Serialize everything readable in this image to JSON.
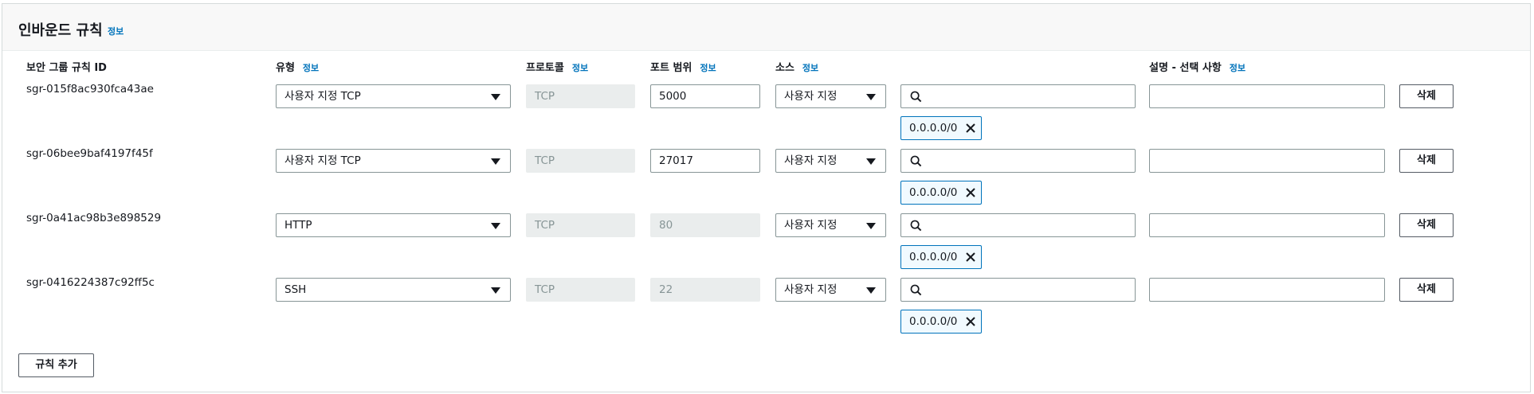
{
  "panel": {
    "title": "인바운드 규칙",
    "info": "정보"
  },
  "columns": {
    "rule_id": "보안 그룹 규칙 ID",
    "type": "유형",
    "protocol": "프로토콜",
    "port_range": "포트 범위",
    "source": "소스",
    "description": "설명 - 선택 사항",
    "info": "정보"
  },
  "rules": [
    {
      "id": "sgr-015f8ac930fca43ae",
      "type": "사용자 지정 TCP",
      "protocol": "TCP",
      "port": "5000",
      "source": "사용자 지정",
      "cidr": "0.0.0.0/0",
      "description": "",
      "delete": "삭제"
    },
    {
      "id": "sgr-06bee9baf4197f45f",
      "type": "사용자 지정 TCP",
      "protocol": "TCP",
      "port": "27017",
      "source": "사용자 지정",
      "cidr": "0.0.0.0/0",
      "description": "",
      "delete": "삭제"
    },
    {
      "id": "sgr-0a41ac98b3e898529",
      "type": "HTTP",
      "protocol": "TCP",
      "port": "80",
      "source": "사용자 지정",
      "cidr": "0.0.0.0/0",
      "description": "",
      "delete": "삭제"
    },
    {
      "id": "sgr-0416224387c92ff5c",
      "type": "SSH",
      "protocol": "TCP",
      "port": "22",
      "source": "사용자 지정",
      "cidr": "0.0.0.0/0",
      "description": "",
      "delete": "삭제"
    }
  ],
  "add_rule_label": "규칙 추가",
  "colors": {
    "accent": "#0073bb",
    "token_bg": "#f1faff",
    "disabled_bg": "#eaeded",
    "border": "#879596"
  }
}
